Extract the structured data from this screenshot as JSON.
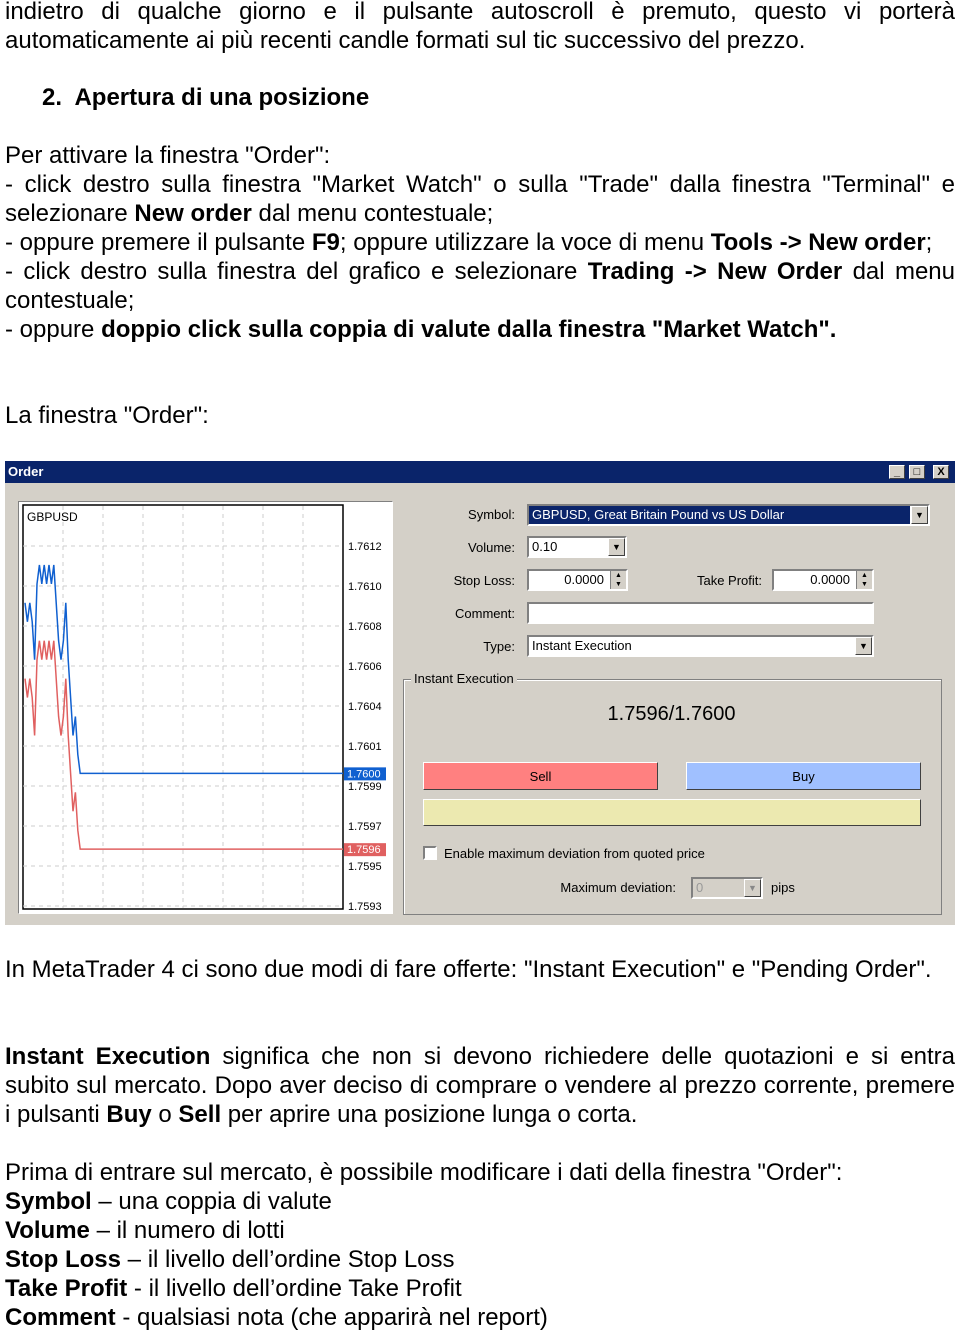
{
  "intro": {
    "text": "indietro di qualche giorno e il pulsante autoscroll è premuto, questo vi porterà automaticamente ai più recenti candle formati sul tic successivo del prezzo."
  },
  "section": {
    "number": "2.",
    "title": "Apertura di una posizione"
  },
  "activate": {
    "lead": "Per attivare la finestra \"Order\":",
    "b1_pre": "- click destro sulla finestra \"Market Watch\" o sulla \"Trade\" dalla finestra \"Terminal\" e selezionare ",
    "b1_bold": "New order",
    "b1_post": " dal menu contestuale;",
    "b2_pre": "- oppure premere il pulsante ",
    "b2_bold1": "F9",
    "b2_mid": "; oppure utilizzare la voce di menu ",
    "b2_bold2": "Tools -> New order",
    "b2_post": ";",
    "b3_pre": "- click destro sulla finestra del grafico e selezionare ",
    "b3_bold": "Trading -> New Order",
    "b3_post": " dal menu contestuale;",
    "b4_pre": "- oppure ",
    "b4_bold": "doppio click sulla coppia di valute dalla finestra \"Market Watch\"."
  },
  "window_caption": "La finestra \"Order\":",
  "dialog": {
    "title": "Order",
    "controls": {
      "minimize": "_",
      "maximize": "□",
      "close": "X"
    },
    "chart": {
      "symbol": "GBPUSD"
    },
    "symbol_label": "Symbol:",
    "symbol_value": "GBPUSD, Great Britain Pound vs US Dollar",
    "volume_label": "Volume:",
    "volume_value": "0.10",
    "stop_loss_label": "Stop Loss:",
    "stop_loss_value": "0.0000",
    "take_profit_label": "Take Profit:",
    "take_profit_value": "0.0000",
    "comment_label": "Comment:",
    "comment_value": "",
    "type_label": "Type:",
    "type_value": "Instant Execution",
    "group_label": "Instant Execution",
    "quote": "1.7596/1.7600",
    "sell_label": "Sell",
    "buy_label": "Buy",
    "deviation_checkbox_label": "Enable maximum deviation from quoted price",
    "deviation_checked": false,
    "max_deviation_label": "Maximum deviation:",
    "max_deviation_value": "0",
    "pips_label": "pips",
    "colors": {
      "title_bar": "#0a246a",
      "sell": "#ff8080",
      "buy": "#a0c0ff",
      "ask_line": "#1060d0",
      "bid_line": "#e06060",
      "info_bar": "#ece9b0"
    }
  },
  "chart_data": {
    "type": "line",
    "title": "GBPUSD",
    "y_ticks": [
      "1.7612",
      "1.7610",
      "1.7608",
      "1.7606",
      "1.7604",
      "1.7601",
      "1.7599",
      "1.7597",
      "1.7595",
      "1.7593"
    ],
    "ylim": [
      1.7593,
      1.7612
    ],
    "grid": true,
    "ask_marker": "1.7600",
    "bid_marker": "1.7596",
    "series": [
      {
        "key": "ask",
        "values": [
          1.7609,
          1.7608,
          1.7609,
          1.7608,
          1.7606,
          1.761,
          1.7611,
          1.761,
          1.7611,
          1.761,
          1.7611,
          1.761,
          1.7611,
          1.7609,
          1.7607,
          1.7606,
          1.7607,
          1.7609,
          1.7606,
          1.7604,
          1.7602,
          1.7603,
          1.7601,
          1.76,
          1.76
        ]
      },
      {
        "key": "bid",
        "values": [
          1.7605,
          1.7604,
          1.7605,
          1.7604,
          1.7602,
          1.7606,
          1.7607,
          1.7606,
          1.7607,
          1.7606,
          1.7607,
          1.7606,
          1.7607,
          1.7605,
          1.7603,
          1.7602,
          1.7603,
          1.7605,
          1.7602,
          1.76,
          1.7598,
          1.7599,
          1.7597,
          1.7596,
          1.7596
        ]
      }
    ]
  },
  "modes": {
    "text": "In MetaTrader 4 ci sono due modi di fare offerte: \"Instant Execution\" e \"Pending Order\"."
  },
  "instant": {
    "bold": "Instant Execution",
    "t1": " significa che non si devono richiedere delle quotazioni e si entra subito sul mercato. Dopo aver deciso di comprare o vendere al prezzo corrente, premere i pulsanti ",
    "buy": "Buy",
    "t2": " o ",
    "sell": "Sell",
    "t3": " per aprire una posizione lunga o corta."
  },
  "fields": {
    "lead": "Prima di entrare sul mercato, è possibile modificare i dati della finestra \"Order\":",
    "items": [
      {
        "term": "Symbol",
        "desc": " – una coppia di valute"
      },
      {
        "term": "Volume",
        "desc": " – il numero di lotti"
      },
      {
        "term": "Stop Loss",
        "desc": " – il livello dell’ordine Stop Loss"
      },
      {
        "term": "Take Profit",
        "desc": " - il livello dell’ordine Take Profit"
      },
      {
        "term": "Comment",
        "desc": " - qualsiasi nota (che apparirà nel report)"
      }
    ]
  }
}
